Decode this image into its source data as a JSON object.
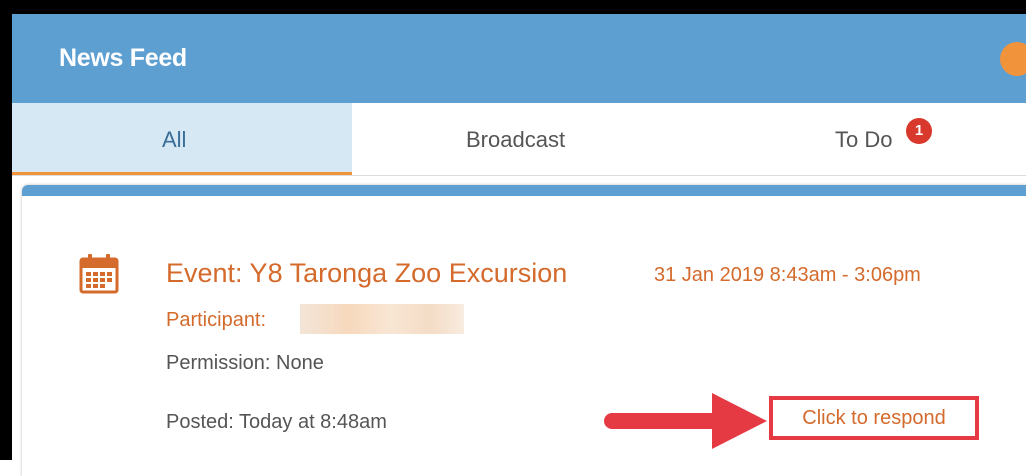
{
  "header": {
    "title": "News Feed"
  },
  "tabs": [
    {
      "label": "All"
    },
    {
      "label": "Broadcast"
    },
    {
      "label": "To Do",
      "badge": "1"
    }
  ],
  "event": {
    "title": "Event: Y8 Taronga Zoo Excursion",
    "date_range": "31 Jan 2019 8:43am - 3:06pm",
    "participant_label": "Participant:",
    "permission": "Permission: None",
    "posted": "Posted: Today at 8:48am",
    "respond_label": "Click to respond",
    "icon": "calendar-icon"
  },
  "colors": {
    "header": "#5e9fd1",
    "accent": "#d46a2b",
    "badge": "#d9382d",
    "annotation": "#e53a43"
  }
}
